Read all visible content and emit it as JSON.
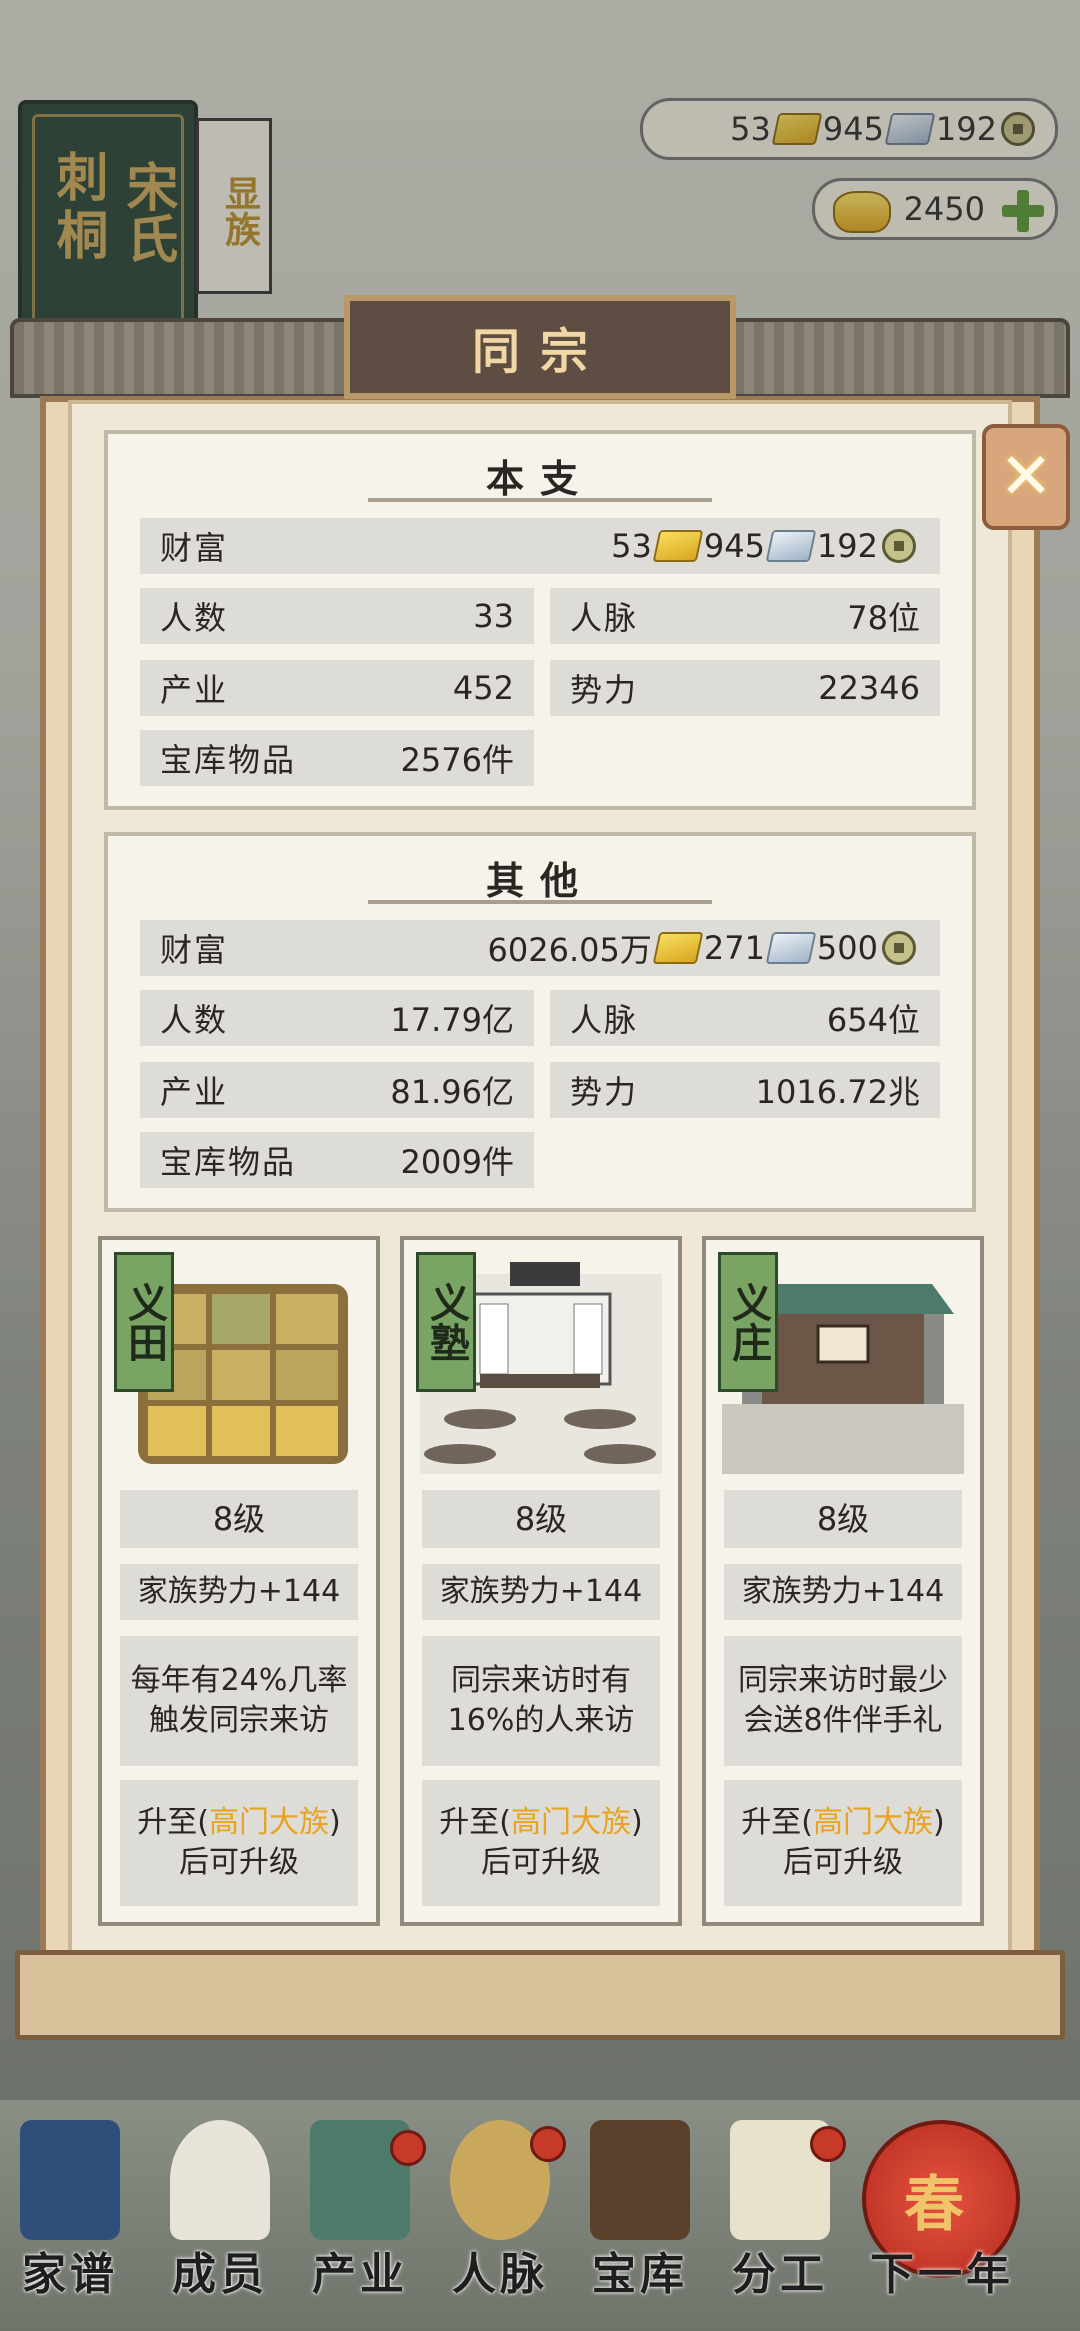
{
  "clan": {
    "name_left": "刺桐",
    "name_right": "宋氏",
    "rank_tag": "显族"
  },
  "currency_bar": {
    "gold_bars": "53",
    "silver_bars": "945",
    "coins": "192"
  },
  "ingots": {
    "value": "2450"
  },
  "dialog": {
    "title": "同宗"
  },
  "main_branch": {
    "title": "本支",
    "wealth_label": "财富",
    "wealth": {
      "gold": "53",
      "silver": "945",
      "coins": "192"
    },
    "people_label": "人数",
    "people": "33",
    "network_label": "人脉",
    "network": "78位",
    "industry_label": "产业",
    "industry": "452",
    "power_label": "势力",
    "power": "22346",
    "treasury_label": "宝库物品",
    "treasury": "2576件"
  },
  "others": {
    "title": "其他",
    "wealth_label": "财富",
    "wealth": {
      "gold": "6026.05万",
      "silver": "271",
      "coins": "500"
    },
    "people_label": "人数",
    "people": "17.79亿",
    "network_label": "人脉",
    "network": "654位",
    "industry_label": "产业",
    "industry": "81.96亿",
    "power_label": "势力",
    "power": "1016.72兆",
    "treasury_label": "宝库物品",
    "treasury": "2009件"
  },
  "buildings": [
    {
      "name": "义田",
      "level": "8级",
      "power": "家族势力+144",
      "desc": "每年有24%几率触发同宗来访",
      "up_prefix": "升至(",
      "up_rank": "高门大族",
      "up_suffix": ")后可升级"
    },
    {
      "name": "义塾",
      "level": "8级",
      "power": "家族势力+144",
      "desc": "同宗来访时有16%的人来访",
      "up_prefix": "升至(",
      "up_rank": "高门大族",
      "up_suffix": ")后可升级"
    },
    {
      "name": "义庄",
      "level": "8级",
      "power": "家族势力+144",
      "desc": "同宗来访时最少会送8件伴手礼",
      "up_prefix": "升至(",
      "up_rank": "高门大族",
      "up_suffix": ")后可升级"
    }
  ],
  "bottom_nav": [
    "家谱",
    "成员",
    "产业",
    "人脉",
    "宝库",
    "分工",
    "下一年"
  ],
  "lantern_text": "春",
  "colors": {
    "highlight": "#e7a321",
    "tag_green": "#79a463",
    "title_plate": "#5d4d42"
  }
}
